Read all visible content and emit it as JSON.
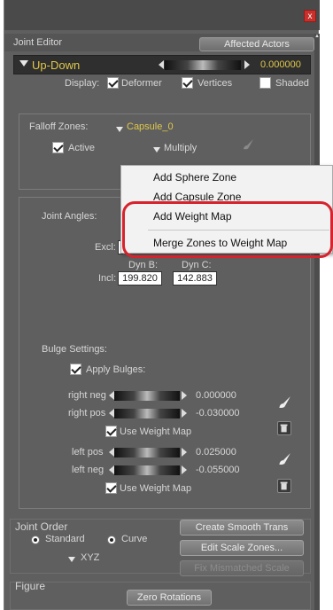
{
  "window": {
    "close_label": "x"
  },
  "header": {
    "title": "Joint Editor",
    "affected_actors": "Affected Actors"
  },
  "parameter": {
    "name": "Up-Down",
    "value": "0.000000"
  },
  "display": {
    "label": "Display:",
    "deformer": "Deformer",
    "vertices": "Vertices",
    "shaded": "Shaded"
  },
  "falloff": {
    "label": "Falloff Zones:",
    "zone": "Capsule_0",
    "active": "Active",
    "multiply": "Multiply"
  },
  "context_menu": {
    "items": [
      "Add Sphere Zone",
      "Add Capsule Zone",
      "Add Weight Map",
      "Merge Zones to Weight Map"
    ],
    "highlight_color": "#d6232d"
  },
  "joint_angles": {
    "label": "Joint Angles:",
    "excl_label": "Excl:",
    "incl_label": "Incl:",
    "dyn_b_label": "Dyn B:",
    "dyn_c_label": "Dyn C:",
    "dyn_b_value": "199.820",
    "dyn_c_value": "142.883"
  },
  "bulge": {
    "label": "Bulge Settings:",
    "apply": "Apply Bulges:",
    "right_neg_label": "right neg",
    "right_neg_value": "0.000000",
    "right_pos_label": "right pos",
    "right_pos_value": "-0.030000",
    "use_weight_map_1": "Use Weight Map",
    "left_pos_label": "left pos",
    "left_pos_value": "0.025000",
    "left_neg_label": "left neg",
    "left_neg_value": "-0.055000",
    "use_weight_map_2": "Use Weight Map"
  },
  "joint_order": {
    "label": "Joint Order",
    "standard": "Standard",
    "curve": "Curve",
    "order": "XYZ",
    "create_smooth": "Create Smooth Trans",
    "edit_scale": "Edit Scale Zones...",
    "fix_mismatched": "Fix Mismatched Scale"
  },
  "figure": {
    "label": "Figure",
    "zero_rotations": "Zero Rotations"
  }
}
